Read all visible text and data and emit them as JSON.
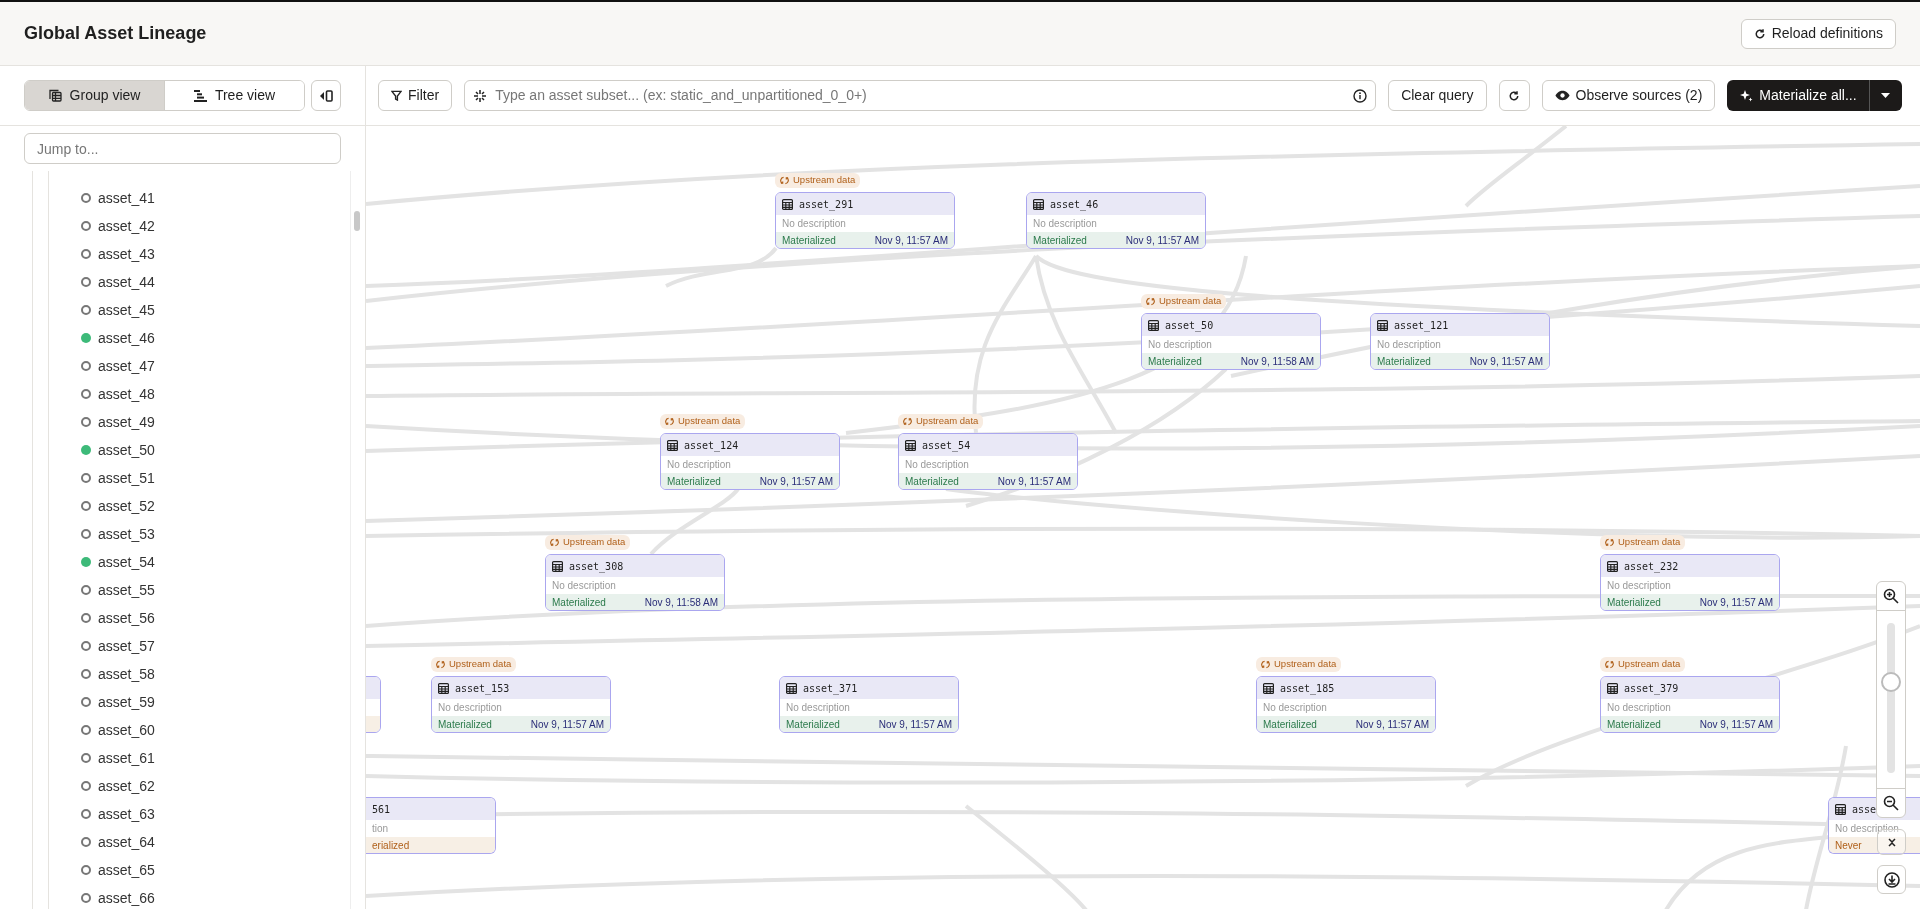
{
  "header": {
    "title": "Global Asset Lineage",
    "reload_button": "Reload definitions"
  },
  "sidebar": {
    "view_tabs": [
      {
        "label": "Group view",
        "kind": "group",
        "selected": true
      },
      {
        "label": "Tree view",
        "kind": "tree",
        "selected": false
      }
    ],
    "search": {
      "placeholder": "Jump to..."
    },
    "assets": [
      {
        "name": "asset_41",
        "materialized": false
      },
      {
        "name": "asset_42",
        "materialized": false
      },
      {
        "name": "asset_43",
        "materialized": false
      },
      {
        "name": "asset_44",
        "materialized": false
      },
      {
        "name": "asset_45",
        "materialized": false
      },
      {
        "name": "asset_46",
        "materialized": true
      },
      {
        "name": "asset_47",
        "materialized": false
      },
      {
        "name": "asset_48",
        "materialized": false
      },
      {
        "name": "asset_49",
        "materialized": false
      },
      {
        "name": "asset_50",
        "materialized": true
      },
      {
        "name": "asset_51",
        "materialized": false
      },
      {
        "name": "asset_52",
        "materialized": false
      },
      {
        "name": "asset_53",
        "materialized": false
      },
      {
        "name": "asset_54",
        "materialized": true
      },
      {
        "name": "asset_55",
        "materialized": false
      },
      {
        "name": "asset_56",
        "materialized": false
      },
      {
        "name": "asset_57",
        "materialized": false
      },
      {
        "name": "asset_58",
        "materialized": false
      },
      {
        "name": "asset_59",
        "materialized": false
      },
      {
        "name": "asset_60",
        "materialized": false
      },
      {
        "name": "asset_61",
        "materialized": false
      },
      {
        "name": "asset_62",
        "materialized": false
      },
      {
        "name": "asset_63",
        "materialized": false
      },
      {
        "name": "asset_64",
        "materialized": false
      },
      {
        "name": "asset_65",
        "materialized": false
      },
      {
        "name": "asset_66",
        "materialized": false
      }
    ]
  },
  "toolbar": {
    "filter_button": "Filter",
    "query": {
      "placeholder": "Type an asset subset... (ex: static_and_unpartitioned_0_0+)"
    },
    "clear_button": "Clear query",
    "observe_button": "Observe sources (2)",
    "materialize_button": "Materialize all..."
  },
  "graph": {
    "nodes": [
      {
        "name": "asset_291",
        "description": "No description",
        "status": "Materialized",
        "materialized": true,
        "timestamp": "Nov 9, 11:57 AM",
        "upstream_badge": "Upstream data"
      },
      {
        "name": "asset_46",
        "description": "No description",
        "status": "Materialized",
        "materialized": true,
        "timestamp": "Nov 9, 11:57 AM"
      },
      {
        "name": "asset_50",
        "description": "No description",
        "status": "Materialized",
        "materialized": true,
        "timestamp": "Nov 9, 11:58 AM",
        "upstream_badge": "Upstream data"
      },
      {
        "name": "asset_121",
        "description": "No description",
        "status": "Materialized",
        "materialized": true,
        "timestamp": "Nov 9, 11:57 AM"
      },
      {
        "name": "asset_124",
        "description": "No description",
        "status": "Materialized",
        "materialized": true,
        "timestamp": "Nov 9, 11:57 AM",
        "upstream_badge": "Upstream data"
      },
      {
        "name": "asset_54",
        "description": "No description",
        "status": "Materialized",
        "materialized": true,
        "timestamp": "Nov 9, 11:57 AM",
        "upstream_badge": "Upstream data"
      },
      {
        "name": "asset_308",
        "description": "No description",
        "status": "Materialized",
        "materialized": true,
        "timestamp": "Nov 9, 11:58 AM",
        "upstream_badge": "Upstream data"
      },
      {
        "name": "asset_232",
        "description": "No description",
        "status": "Materialized",
        "materialized": true,
        "timestamp": "Nov 9, 11:57 AM",
        "upstream_badge": "Upstream data"
      },
      {
        "materialized": false
      },
      {
        "name": "asset_153",
        "description": "No description",
        "status": "Materialized",
        "materialized": true,
        "timestamp": "Nov 9, 11:57 AM",
        "upstream_badge": "Upstream data"
      },
      {
        "name": "asset_371",
        "description": "No description",
        "status": "Materialized",
        "materialized": true,
        "timestamp": "Nov 9, 11:57 AM"
      },
      {
        "name": "asset_185",
        "description": "No description",
        "status": "Materialized",
        "materialized": true,
        "timestamp": "Nov 9, 11:57 AM",
        "upstream_badge": "Upstream data"
      },
      {
        "name": "asset_379",
        "description": "No description",
        "status": "Materialized",
        "materialized": true,
        "timestamp": "Nov 9, 11:57 AM",
        "upstream_badge": "Upstream data"
      },
      {
        "name": "561",
        "description": "tion",
        "status": "erialized",
        "materialized": false
      },
      {
        "name": "asse",
        "description": "No description",
        "status": "Never",
        "materialized": false
      }
    ]
  },
  "zoom": {
    "level": 0.61
  }
}
